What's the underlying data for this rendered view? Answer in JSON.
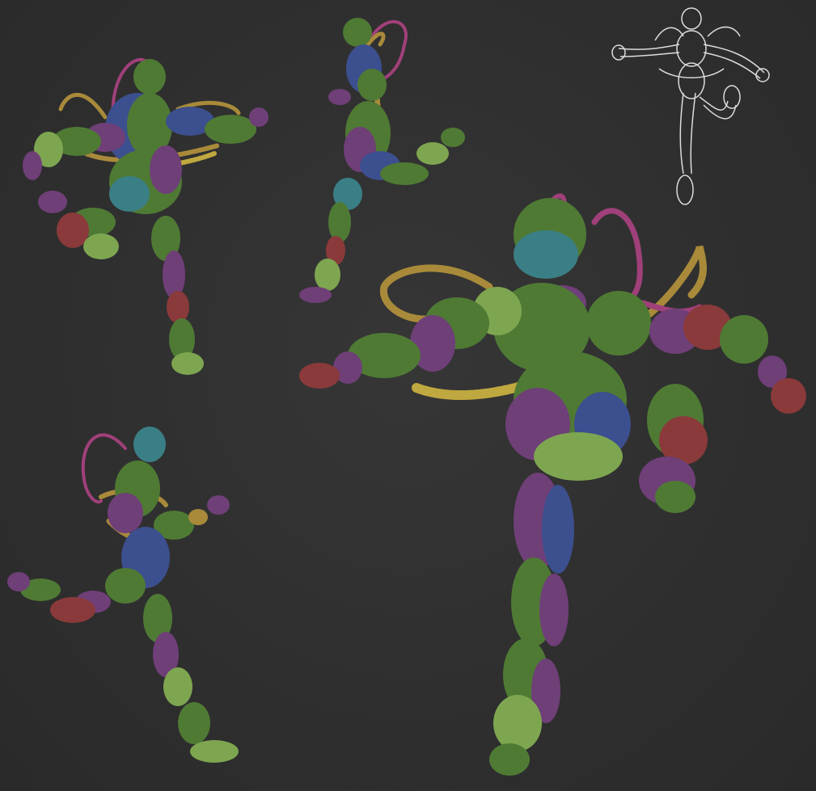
{
  "scene": {
    "background": "#303030",
    "palette": {
      "green": "#4f7a34",
      "green_light": "#7ea650",
      "purple": "#6f3f78",
      "blue": "#3c4f8e",
      "red": "#8a3a3a",
      "teal": "#3a7f85",
      "gold": "#a88a3a",
      "magenta": "#a0407a",
      "wire": "#dcdcdc"
    },
    "figures": [
      {
        "id": "back-view",
        "style": "zsphere-segments"
      },
      {
        "id": "side-view",
        "style": "zsphere-segments"
      },
      {
        "id": "wireframe-preview",
        "style": "wireframe"
      },
      {
        "id": "lower-left-view",
        "style": "zsphere-segments"
      },
      {
        "id": "main-front-view",
        "style": "zsphere-segments"
      }
    ]
  }
}
